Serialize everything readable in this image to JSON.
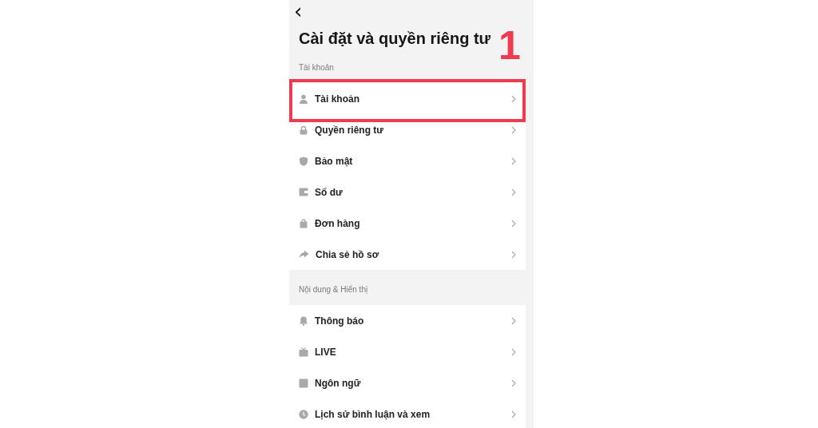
{
  "header": {
    "back": "‹",
    "title": "Cài đặt và quyền riêng tư"
  },
  "annotation": {
    "label": "1"
  },
  "sections": [
    {
      "label": "Tài khoản",
      "items": [
        {
          "label": "Tài khoản",
          "highlighted": true
        },
        {
          "label": "Quyền riêng tư",
          "highlighted": false
        },
        {
          "label": "Bảo mật",
          "highlighted": false
        },
        {
          "label": "Số dư",
          "highlighted": false
        },
        {
          "label": "Đơn hàng",
          "highlighted": false
        },
        {
          "label": "Chia sẻ hồ sơ",
          "highlighted": false
        }
      ]
    },
    {
      "label": "Nội dung & Hiển thị",
      "items": [
        {
          "label": "Thông báo",
          "highlighted": false
        },
        {
          "label": "LIVE",
          "highlighted": false
        },
        {
          "label": "Ngôn ngữ",
          "highlighted": false
        },
        {
          "label": "Lịch sử bình luận và xem",
          "highlighted": false
        }
      ]
    }
  ]
}
